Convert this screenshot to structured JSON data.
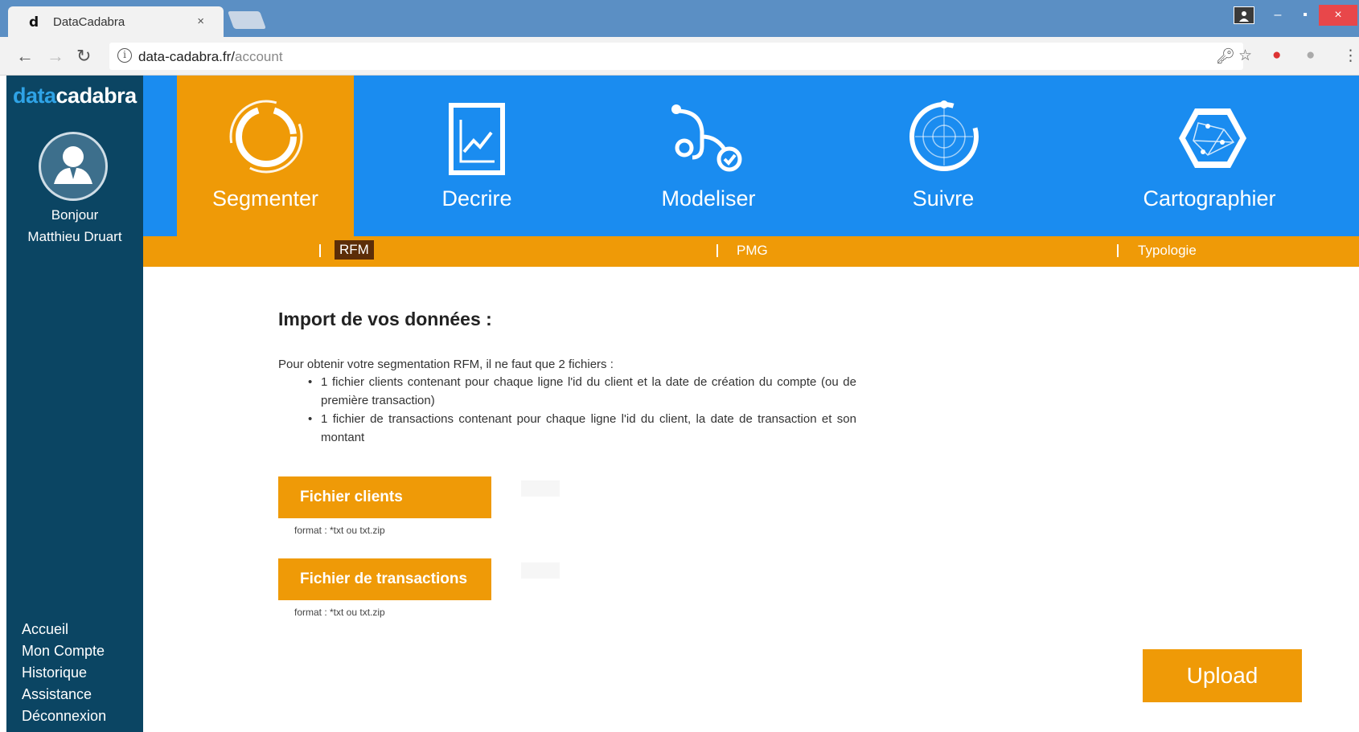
{
  "browser": {
    "tab_title": "DataCadabra",
    "tab_icon": "d",
    "tab_close": "×",
    "url_host": "data-cadabra.fr/",
    "url_path": "account",
    "win_min": "–",
    "win_max": "▪",
    "win_close": "×"
  },
  "sidebar": {
    "logo_accent": "data",
    "logo_main": "cadabra",
    "greeting_line1": "Bonjour",
    "greeting_line2": "Matthieu Druart",
    "items": [
      {
        "label": "Accueil"
      },
      {
        "label": "Mon Compte"
      },
      {
        "label": "Historique"
      },
      {
        "label": "Assistance"
      },
      {
        "label": "Déconnexion"
      }
    ]
  },
  "topnav": {
    "tiles": [
      {
        "label": "Segmenter",
        "icon": "segment-ring-icon",
        "active": true
      },
      {
        "label": "Decrire",
        "icon": "chart-document-icon",
        "active": false
      },
      {
        "label": "Modeliser",
        "icon": "stethoscope-icon",
        "active": false
      },
      {
        "label": "Suivre",
        "icon": "target-radar-icon",
        "active": false
      },
      {
        "label": "Cartographier",
        "icon": "hexagon-map-icon",
        "active": false
      }
    ]
  },
  "subnav": {
    "items": [
      {
        "label": "RFM",
        "active": true
      },
      {
        "label": "PMG",
        "active": false
      },
      {
        "label": "Typologie",
        "active": false
      }
    ]
  },
  "main": {
    "title": "Import de vos données :",
    "intro": "Pour obtenir votre segmentation RFM, il ne faut que 2 fichiers :",
    "bullets": [
      "1 fichier clients contenant pour chaque ligne l'id du client et la date de création du compte (ou de première transaction)",
      "1 fichier de transactions contenant pour chaque ligne l'id du client, la date de transaction et son montant"
    ],
    "file_clients": {
      "label": "Fichier clients",
      "hint": "format : *txt ou txt.zip"
    },
    "file_transactions": {
      "label": "Fichier de transactions",
      "hint": "format : *txt ou txt.zip"
    },
    "upload_label": "Upload"
  },
  "colors": {
    "primary_blue": "#1a8cf0",
    "accent_orange": "#ef9a07",
    "sidebar_navy": "#0b4563"
  }
}
